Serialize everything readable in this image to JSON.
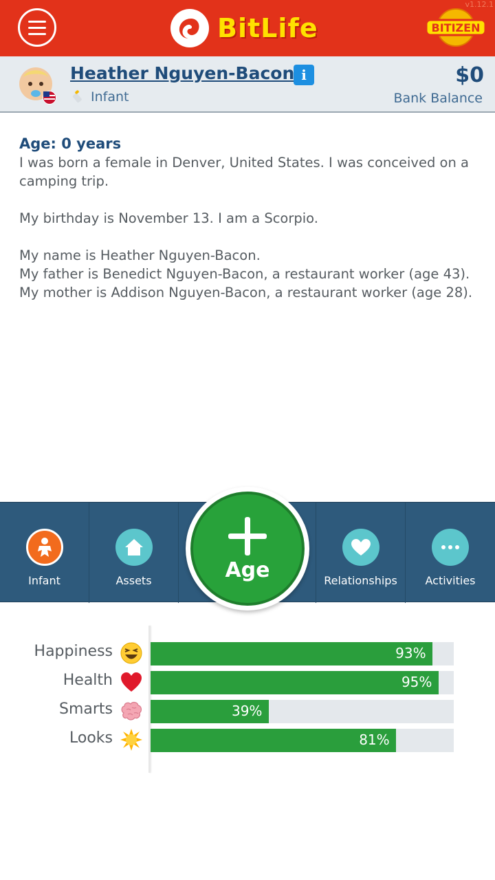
{
  "header": {
    "app_name": "BitLife",
    "version": "v1.12.1",
    "badge": "BITIZEN",
    "colors": {
      "bar": "#e2321a",
      "logo_text": "#ffe100"
    }
  },
  "profile": {
    "name": "Heather Nguyen-Bacon",
    "info_label": "i",
    "stage": "Infant",
    "balance": "$0",
    "balance_label": "Bank Balance"
  },
  "story": {
    "age_heading": "Age: 0 years",
    "lines": [
      "I was born a female in Denver, United States. I was conceived on a camping trip.",
      "My birthday is November 13. I am a Scorpio.",
      "My name is Heather Nguyen-Bacon.",
      "My father is Benedict Nguyen-Bacon, a restaurant worker (age 43).",
      "My mother is Addison Nguyen-Bacon, a restaurant worker (age 28)."
    ]
  },
  "nav": {
    "items": [
      {
        "label": "Infant",
        "icon": "baby-icon",
        "color": "#f26b1d"
      },
      {
        "label": "Assets",
        "icon": "house-icon",
        "color": "#5cc6cc"
      },
      {
        "label": "Relationships",
        "icon": "heart-icon",
        "color": "#5cc6cc"
      },
      {
        "label": "Activities",
        "icon": "dots-icon",
        "color": "#5cc6cc"
      }
    ],
    "age_button": {
      "label": "Age",
      "icon": "plus-icon",
      "color": "#28a23a"
    }
  },
  "stats": [
    {
      "label": "Happiness",
      "icon": "laughing-face-icon",
      "value": 93,
      "text": "93%"
    },
    {
      "label": "Health",
      "icon": "heart-icon",
      "value": 95,
      "text": "95%"
    },
    {
      "label": "Smarts",
      "icon": "brain-icon",
      "value": 39,
      "text": "39%"
    },
    {
      "label": "Looks",
      "icon": "sun-icon",
      "value": 81,
      "text": "81%"
    }
  ]
}
